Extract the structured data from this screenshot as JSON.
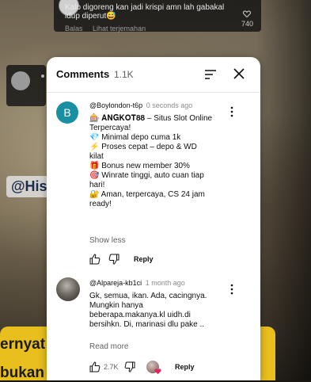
{
  "background": {
    "ghost_comment": {
      "text": "Kalo digoreng kan jadi krispi amn lah gabakal idup diperut😅",
      "like_count": "740",
      "actions": [
        "Balas",
        "Lihat terjemahan"
      ]
    },
    "handle_overlay": "@His",
    "caption_lines": [
      "ernyat",
      "bukan"
    ]
  },
  "panel": {
    "title": "Comments",
    "count": "1.1K"
  },
  "comments": [
    {
      "avatar_letter": "B",
      "author": "@Boylondon-t6p",
      "time": "0 seconds ago",
      "lines": [
        "🎰 𝐀𝐍𝐆𝐊𝐎𝐓𝟖𝟖 – Situs Slot Online",
        "Terpercaya!",
        "💎 Minimal depo cuma 1k",
        "⚡ Proses cepat – depo & WD",
        "kilat",
        "🎁 Bonus new member 30%",
        "🎯 Winrate tinggi, auto cuan tiap",
        "hari!",
        "🔐 Aman, terpercaya, CS 24 jam",
        "ready!"
      ],
      "toggle": "Show less",
      "likes": "",
      "reply": "Reply"
    },
    {
      "author": "@Alpareja-kb1ci",
      "time": "1 month ago",
      "lines": [
        "Gk, semua, ikan. Ada, cacingnya.",
        "Mungkin hanya",
        "beberapa.makanya.kl uidh.di",
        "bersihkn. Di, marinasi dlu pake .."
      ],
      "toggle": "Read more",
      "likes": "2.7K",
      "reply": "Reply"
    }
  ],
  "icons": {
    "sort": "sort-icon",
    "close": "close-icon",
    "more": "more-vert-icon",
    "like": "thumb-up-icon",
    "dislike": "thumb-down-icon"
  },
  "colors": {
    "avatar_b": "#1a8fa3",
    "caption_bg": "#e8bf1c",
    "creator_heart": "#e0245e"
  }
}
